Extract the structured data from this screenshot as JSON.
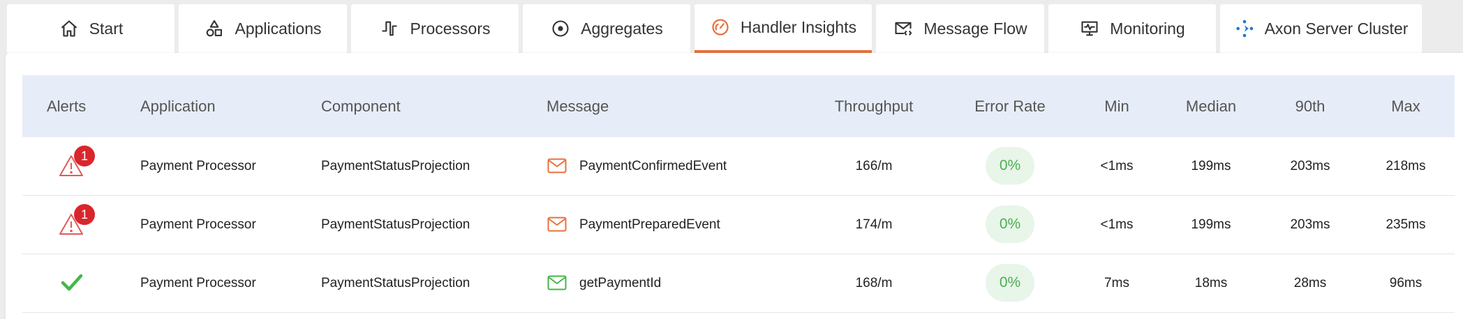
{
  "tabs": [
    {
      "id": "start",
      "label": "Start",
      "icon": "home-icon"
    },
    {
      "id": "applications",
      "label": "Applications",
      "icon": "shapes-icon"
    },
    {
      "id": "processors",
      "label": "Processors",
      "icon": "processor-icon"
    },
    {
      "id": "aggregates",
      "label": "Aggregates",
      "icon": "target-icon"
    },
    {
      "id": "handler_insights",
      "label": "Handler Insights",
      "icon": "gauge-icon",
      "active": true
    },
    {
      "id": "message_flow",
      "label": "Message Flow",
      "icon": "envelope-code-icon"
    },
    {
      "id": "monitoring",
      "label": "Monitoring",
      "icon": "monitor-icon"
    },
    {
      "id": "axon_server_cluster",
      "label": "Axon Server Cluster",
      "icon": "axon-logo-icon"
    }
  ],
  "colors": {
    "accent": "#e9703a",
    "header_bg": "#e6edf8",
    "alert_red": "#d9262d",
    "ok_green": "#43b649",
    "error_pill_bg": "#e8f5e9",
    "error_pill_text": "#4caf50"
  },
  "table": {
    "columns": {
      "alerts": "Alerts",
      "application": "Application",
      "component": "Component",
      "message": "Message",
      "throughput": "Throughput",
      "error_rate": "Error Rate",
      "min": "Min",
      "median": "Median",
      "p90": "90th",
      "max": "Max"
    },
    "rows": [
      {
        "alert": "warning",
        "alert_count": "1",
        "application": "Payment Processor",
        "component": "PaymentStatusProjection",
        "message_type": "event",
        "message": "PaymentConfirmedEvent",
        "throughput": "166/m",
        "error_rate": "0%",
        "min": "<1ms",
        "median": "199ms",
        "p90": "203ms",
        "max": "218ms"
      },
      {
        "alert": "warning",
        "alert_count": "1",
        "application": "Payment Processor",
        "component": "PaymentStatusProjection",
        "message_type": "event",
        "message": "PaymentPreparedEvent",
        "throughput": "174/m",
        "error_rate": "0%",
        "min": "<1ms",
        "median": "199ms",
        "p90": "203ms",
        "max": "235ms"
      },
      {
        "alert": "ok",
        "alert_count": "",
        "application": "Payment Processor",
        "component": "PaymentStatusProjection",
        "message_type": "query",
        "message": "getPaymentId",
        "throughput": "168/m",
        "error_rate": "0%",
        "min": "7ms",
        "median": "18ms",
        "p90": "28ms",
        "max": "96ms"
      }
    ]
  }
}
